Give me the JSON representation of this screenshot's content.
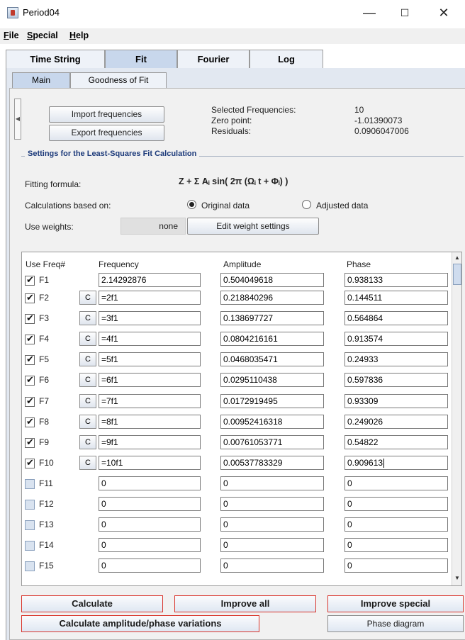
{
  "window": {
    "title": "Period04"
  },
  "menu": [
    "File",
    "Special",
    "Help"
  ],
  "outer_tabs": [
    "Time String",
    "Fit",
    "Fourier",
    "Log"
  ],
  "inner_tabs": [
    "Main",
    "Goodness of Fit"
  ],
  "buttons": {
    "import": "Import frequencies",
    "export": "Export frequencies",
    "edit_weights": "Edit weight settings",
    "calculate": "Calculate",
    "improve_all": "Improve all",
    "improve_special": "Improve special",
    "calc_variations": "Calculate amplitude/phase variations",
    "phase_diagram": "Phase diagram"
  },
  "summary": {
    "selected_label": "Selected Frequencies:",
    "selected_value": "10",
    "zero_label": "Zero point:",
    "zero_value": "-1.01390073",
    "residuals_label": "Residuals:",
    "residuals_value": "0.0906047006"
  },
  "settings": {
    "title": "Settings for the Least-Squares Fit Calculation",
    "formula_label": "Fitting formula:",
    "formula": "Z + Σ Aᵢ sin( 2π (Ωᵢ t + Φᵢ) )",
    "calc_label": "Calculations based on:",
    "original": "Original data",
    "adjusted": "Adjusted data",
    "weights_label": "Use weights:",
    "weights_value": "none"
  },
  "table": {
    "headers": [
      "Use Freq#",
      "Frequency",
      "Amplitude",
      "Phase"
    ],
    "rows": [
      {
        "id": "F1",
        "checked": true,
        "c": "",
        "freq": "2.14292876",
        "amp": "0.504049618",
        "phase": "0.938133"
      },
      {
        "id": "F2",
        "checked": true,
        "c": "C",
        "freq": "=2f1",
        "amp": "0.218840296",
        "phase": "0.144511"
      },
      {
        "id": "F3",
        "checked": true,
        "c": "C",
        "freq": "=3f1",
        "amp": "0.138697727",
        "phase": "0.564864"
      },
      {
        "id": "F4",
        "checked": true,
        "c": "C",
        "freq": "=4f1",
        "amp": "0.0804216161",
        "phase": "0.913574"
      },
      {
        "id": "F5",
        "checked": true,
        "c": "C",
        "freq": "=5f1",
        "amp": "0.0468035471",
        "phase": "0.24933"
      },
      {
        "id": "F6",
        "checked": true,
        "c": "C",
        "freq": "=6f1",
        "amp": "0.0295110438",
        "phase": "0.597836"
      },
      {
        "id": "F7",
        "checked": true,
        "c": "C",
        "freq": "=7f1",
        "amp": "0.0172919495",
        "phase": "0.93309"
      },
      {
        "id": "F8",
        "checked": true,
        "c": "C",
        "freq": "=8f1",
        "amp": "0.00952416318",
        "phase": "0.249026"
      },
      {
        "id": "F9",
        "checked": true,
        "c": "C",
        "freq": "=9f1",
        "amp": "0.00761053771",
        "phase": "0.54822"
      },
      {
        "id": "F10",
        "checked": true,
        "c": "C",
        "freq": "=10f1",
        "amp": "0.00537783329",
        "phase": "0.909613"
      },
      {
        "id": "F11",
        "checked": false,
        "c": "",
        "freq": "0",
        "amp": "0",
        "phase": "0"
      },
      {
        "id": "F12",
        "checked": false,
        "c": "",
        "freq": "0",
        "amp": "0",
        "phase": "0"
      },
      {
        "id": "F13",
        "checked": false,
        "c": "",
        "freq": "0",
        "amp": "0",
        "phase": "0"
      },
      {
        "id": "F14",
        "checked": false,
        "c": "",
        "freq": "0",
        "amp": "0",
        "phase": "0"
      },
      {
        "id": "F15",
        "checked": false,
        "c": "",
        "freq": "0",
        "amp": "0",
        "phase": "0"
      }
    ]
  },
  "colors": {
    "accent_red": "#d9342b",
    "tab_active": "#c8d7ec",
    "group_title": "#1c3a7a"
  }
}
